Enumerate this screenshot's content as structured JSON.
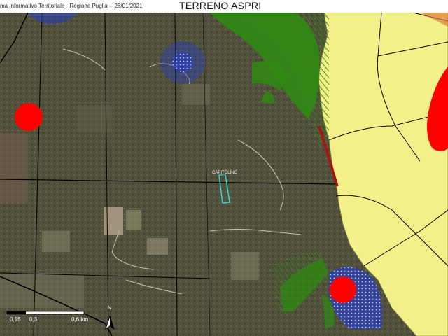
{
  "header": {
    "credit": "ma Informativo Territoriale - Regione Puglia  -- 28/01/2021",
    "title": "TERRENO ASPRI"
  },
  "map": {
    "parcel_label": "CAPITOLINO",
    "north_arrow_label": "N",
    "scale_bar": {
      "labels": [
        "0,15",
        "0,3",
        "0,6 km"
      ]
    },
    "layers": [
      {
        "name": "urban-zone",
        "color": "#f3f08a"
      },
      {
        "name": "protected-green-area",
        "color": "#2f8a12"
      },
      {
        "name": "risk-zone",
        "color": "#ff0000"
      },
      {
        "name": "water-buffer",
        "color": "#2a3fb3"
      },
      {
        "name": "parcel-outline",
        "color": "#33dddd"
      }
    ]
  }
}
